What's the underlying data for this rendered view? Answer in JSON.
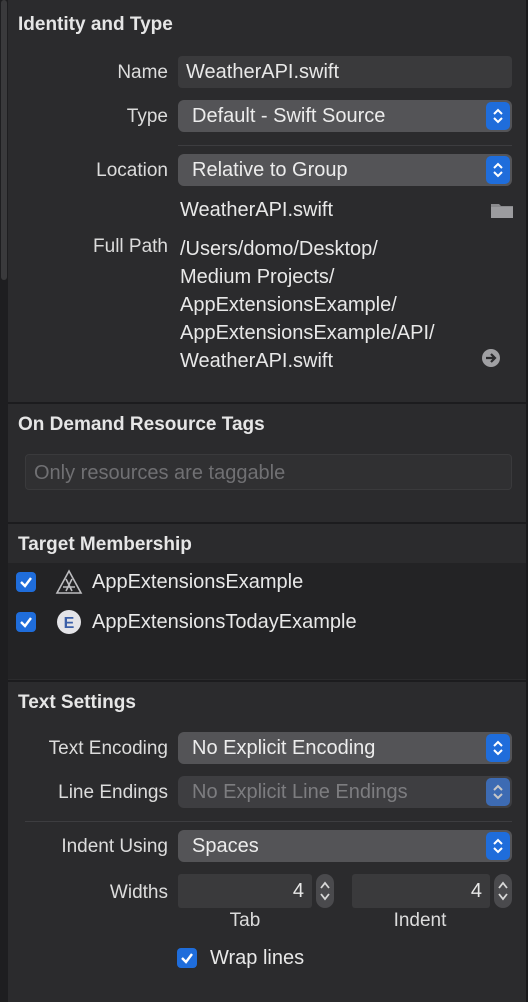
{
  "identity": {
    "title": "Identity and Type",
    "name_label": "Name",
    "name_value": "WeatherAPI.swift",
    "type_label": "Type",
    "type_value": "Default - Swift Source",
    "location_label": "Location",
    "location_value": "Relative to Group",
    "file_name": "WeatherAPI.swift",
    "full_path_label": "Full Path",
    "full_path_lines": [
      "/Users/domo/Desktop/",
      "Medium Projects/",
      "AppExtensionsExample/",
      "AppExtensionsExample/API/",
      "WeatherAPI.swift"
    ]
  },
  "on_demand": {
    "title": "On Demand Resource Tags",
    "placeholder": "Only resources are taggable"
  },
  "membership": {
    "title": "Target Membership",
    "targets": [
      {
        "label": "AppExtensionsExample",
        "checked": true,
        "icon": "app-store-icon"
      },
      {
        "label": "AppExtensionsTodayExample",
        "checked": true,
        "icon": "extension-e-icon"
      }
    ]
  },
  "text_settings": {
    "title": "Text Settings",
    "encoding_label": "Text Encoding",
    "encoding_value": "No Explicit Encoding",
    "line_endings_label": "Line Endings",
    "line_endings_value": "No Explicit Line Endings",
    "indent_label": "Indent Using",
    "indent_value": "Spaces",
    "widths_label": "Widths",
    "tab_value": "4",
    "tab_label": "Tab",
    "indent_width_value": "4",
    "indent_width_label": "Indent",
    "wrap_label": "Wrap lines",
    "wrap_checked": true
  },
  "colors": {
    "background": "#2b2b2d",
    "accent": "#1f6ddb",
    "popup": "#545457"
  }
}
